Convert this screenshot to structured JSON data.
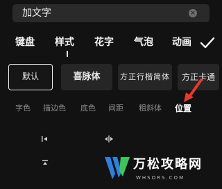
{
  "input": {
    "value": "加文字",
    "clear_symbol": "×"
  },
  "tabs": {
    "items": [
      {
        "label": "键盘"
      },
      {
        "label": "样式"
      },
      {
        "label": "花字"
      },
      {
        "label": "气泡"
      },
      {
        "label": "动画"
      }
    ],
    "active": "样式",
    "confirm_icon": "check-icon"
  },
  "fonts": {
    "items": [
      {
        "label": "默认"
      },
      {
        "label": "喜脉体"
      },
      {
        "label": "方正行楷简体"
      },
      {
        "label": "方正卡通"
      }
    ],
    "selected": "默认"
  },
  "subtabs": {
    "items": [
      {
        "label": "字色"
      },
      {
        "label": "描边色"
      },
      {
        "label": "底色"
      },
      {
        "label": "间距"
      },
      {
        "label": "粗斜体"
      },
      {
        "label": "位置"
      }
    ],
    "active": "位置"
  },
  "align": {
    "icons": [
      "align-left-icon",
      "align-center-icon",
      "align-top-icon"
    ]
  },
  "annotation": {
    "color": "#e8392b"
  },
  "watermark": {
    "title": "万松攻略网",
    "subtitle": "WHSORS.COM",
    "logo_color_blue": "#2f7fe0",
    "logo_color_green": "#3fc45a"
  }
}
